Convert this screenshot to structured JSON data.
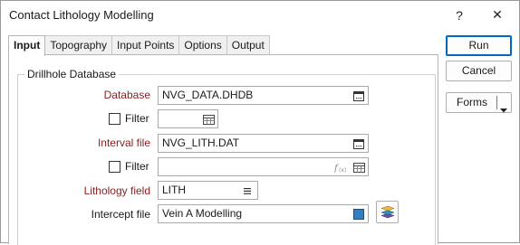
{
  "window": {
    "title": "Contact Lithology Modelling",
    "help_label": "?",
    "close_label": "✕"
  },
  "tabs": [
    {
      "label": "Input"
    },
    {
      "label": "Topography"
    },
    {
      "label": "Input Points"
    },
    {
      "label": "Options"
    },
    {
      "label": "Output"
    }
  ],
  "group": {
    "label": "Drillhole Database"
  },
  "fields": {
    "database": {
      "label": "Database",
      "value": "NVG_DATA.DHDB"
    },
    "filter1": {
      "label": "Filter",
      "value": ""
    },
    "interval_file": {
      "label": "Interval file",
      "value": "NVG_LITH.DAT"
    },
    "filter2": {
      "label": "Filter",
      "value": ""
    },
    "lithology_field": {
      "label": "Lithology field",
      "value": "LITH"
    },
    "intercept_file": {
      "label": "Intercept file",
      "value": "Vein A Modelling"
    }
  },
  "buttons": {
    "run": "Run",
    "cancel": "Cancel",
    "forms": "Forms"
  },
  "colors": {
    "required_label": "#8b1d1d",
    "primary_border": "#0067c0",
    "color_swatch": "#2f7fc1"
  },
  "icons": [
    "browse-icon",
    "filter-table-icon",
    "function-icon",
    "list-icon",
    "color-swatch-icon",
    "layers-icon",
    "dropdown-arrow-icon"
  ]
}
